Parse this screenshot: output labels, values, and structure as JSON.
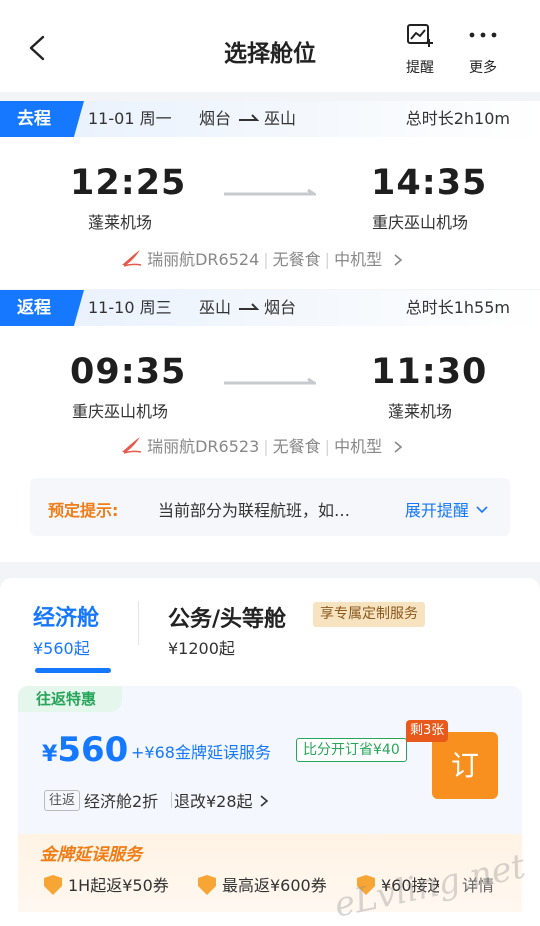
{
  "header": {
    "title": "选择舱位",
    "remind_label": "提醒",
    "more_label": "更多"
  },
  "outbound": {
    "tag": "去程",
    "date": "11-01 周一",
    "from_city": "烟台",
    "to_city": "巫山",
    "duration": "总时长2h10m",
    "dep_time": "12:25",
    "arr_time": "14:35",
    "dep_airport": "蓬莱机场",
    "arr_airport": "重庆巫山机场",
    "airline": "瑞丽航DR6524",
    "meal": "无餐食",
    "aircraft": "中机型"
  },
  "return": {
    "tag": "返程",
    "date": "11-10 周三",
    "from_city": "巫山",
    "to_city": "烟台",
    "duration": "总时长1h55m",
    "dep_time": "09:35",
    "arr_time": "11:30",
    "dep_airport": "重庆巫山机场",
    "arr_airport": "蓬莱机场",
    "airline": "瑞丽航DR6523",
    "meal": "无餐食",
    "aircraft": "中机型"
  },
  "notice": {
    "label": "预定提示:",
    "text": "当前部分为联程航班，如…",
    "expand": "展开提醒"
  },
  "cabin_tabs": {
    "economy_label": "经济舱",
    "economy_price": "¥560起",
    "business_label": "公务/头等舱",
    "business_price": "¥1200起",
    "vip_tag": "享专属定制服务"
  },
  "fare": {
    "tag": "往返特惠",
    "currency": "¥",
    "price": "560",
    "service": "+¥68金牌延误服务",
    "save_tag": "比分开订省¥40",
    "remaining": "剩3张",
    "book_label": "订",
    "roundtrip_badge": "往返",
    "cabin_class": "经济舱2折",
    "policy": "退改¥28起",
    "gold_title": "金牌延误服务",
    "benefits": [
      "1H起返¥50券",
      "最高返¥600券",
      "¥60接送"
    ],
    "detail_label": "详情"
  },
  "watermark": "eLvling.net",
  "colors": {
    "accent": "#1677ff",
    "orange": "#f7901e",
    "green": "#27a55a"
  }
}
